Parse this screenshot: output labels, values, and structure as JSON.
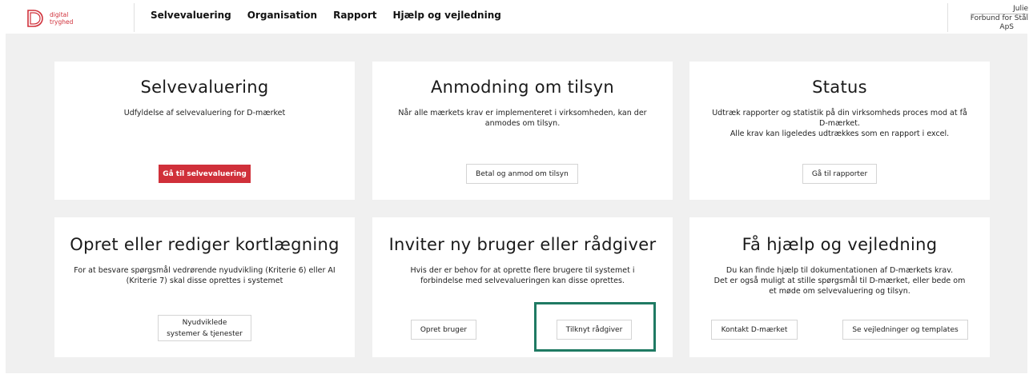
{
  "brand": {
    "line1": "digital",
    "line2": "tryghed",
    "accent": "#d0303a"
  },
  "nav": [
    "Selvevaluering",
    "Organisation",
    "Rapport",
    "Hjælp og vejledning"
  ],
  "user": {
    "name": "Julie",
    "org_line1": "Forbund for Stål",
    "org_line2": "ApS"
  },
  "cards": [
    {
      "title": "Selvevaluering",
      "text": [
        "Udfyldelse af selvevaluering for D-mærket"
      ],
      "buttons": [
        [
          "Gå til selvevaluering"
        ]
      ]
    },
    {
      "title": "Anmodning om tilsyn",
      "text": [
        "Når alle mærkets krav er implementeret i virksomheden, kan der",
        "anmodes om tilsyn."
      ],
      "buttons": [
        [
          "Betal og anmod om tilsyn"
        ]
      ]
    },
    {
      "title": "Status",
      "text": [
        "Udtræk rapporter og statistik på din virksomheds proces mod at få",
        "D-mærket.",
        "Alle krav kan ligeledes udtrækkes som en rapport i excel."
      ],
      "buttons": [
        [
          "Gå til rapporter"
        ]
      ]
    },
    {
      "title": "Opret eller rediger kortlægning",
      "text": [
        "For at besvare spørgsmål vedrørende nyudvikling (Kriterie 6) eller AI",
        "(Kriterie 7) skal disse oprettes i systemet"
      ],
      "buttons": [
        [
          "Nyudviklede",
          "systemer & tjenester"
        ]
      ]
    },
    {
      "title": "Inviter ny bruger eller rådgiver",
      "text": [
        "Hvis der er behov for at oprette flere brugere til systemet i",
        "forbindelse med selvevalueringen kan disse oprettes."
      ],
      "buttons": [
        [
          "Opret bruger"
        ],
        [
          "Tilknyt rådgiver"
        ]
      ]
    },
    {
      "title": "Få hjælp og vejledning",
      "text": [
        "Du kan finde hjælp til dokumentationen af D-mærkets krav.",
        "Det er også muligt at stille spørgsmål til D-mærket, eller bede om",
        "et møde om selvevaluering og tilsyn."
      ],
      "buttons": [
        [
          "Kontakt D-mærket"
        ],
        [
          "Se vejledninger og templates"
        ]
      ]
    }
  ],
  "highlight_color": "#1f7a63"
}
